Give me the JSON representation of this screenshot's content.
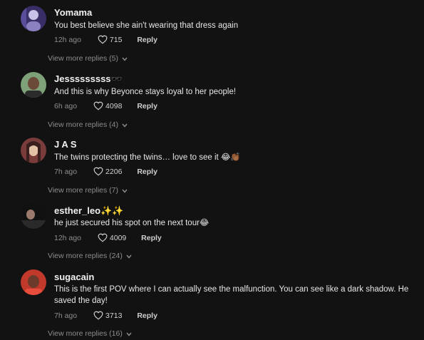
{
  "comments": [
    {
      "username": "Yomama",
      "text": "You best believe she ain't wearing that dress again",
      "time": "12h ago",
      "likes": "715",
      "reply_label": "Reply",
      "view_more": "View more replies (5)",
      "avatar_colors": [
        "#3a2e66",
        "#c9c2e8"
      ]
    },
    {
      "username": "Jesssssssss🕶️",
      "text": "And this is why Beyonce stays loyal to her people!",
      "time": "6h ago",
      "likes": "4098",
      "reply_label": "Reply",
      "view_more": "View more replies (4)",
      "avatar_colors": [
        "#7fa17a",
        "#6b4a3a"
      ]
    },
    {
      "username": "J A S",
      "text": "The twins protecting the twins… love to see it 😂👏🏾",
      "time": "7h ago",
      "likes": "2206",
      "reply_label": "Reply",
      "view_more": "View more replies (7)",
      "avatar_colors": [
        "#7a3b3b",
        "#e3c3a8"
      ]
    },
    {
      "username": "esther_leo✨✨",
      "text": "he just secured his spot on the next tour😂",
      "time": "12h ago",
      "likes": "4009",
      "reply_label": "Reply",
      "view_more": "View more replies (24)",
      "avatar_colors": [
        "#111111",
        "#9a7b6b"
      ]
    },
    {
      "username": "sugacain",
      "text": "This is the first POV where I can actually see the malfunction. You can see like a dark shadow. He saved the day!",
      "time": "7h ago",
      "likes": "3713",
      "reply_label": "Reply",
      "view_more": "View more replies (16)",
      "avatar_colors": [
        "#c0392b",
        "#6b3a2a"
      ]
    }
  ],
  "colors": {
    "background": "#121212",
    "primary_text": "#e6e6e6",
    "secondary_text": "#8d8d8d"
  },
  "icons": {
    "like": "heart-outline-icon",
    "expand": "chevron-down-icon"
  }
}
